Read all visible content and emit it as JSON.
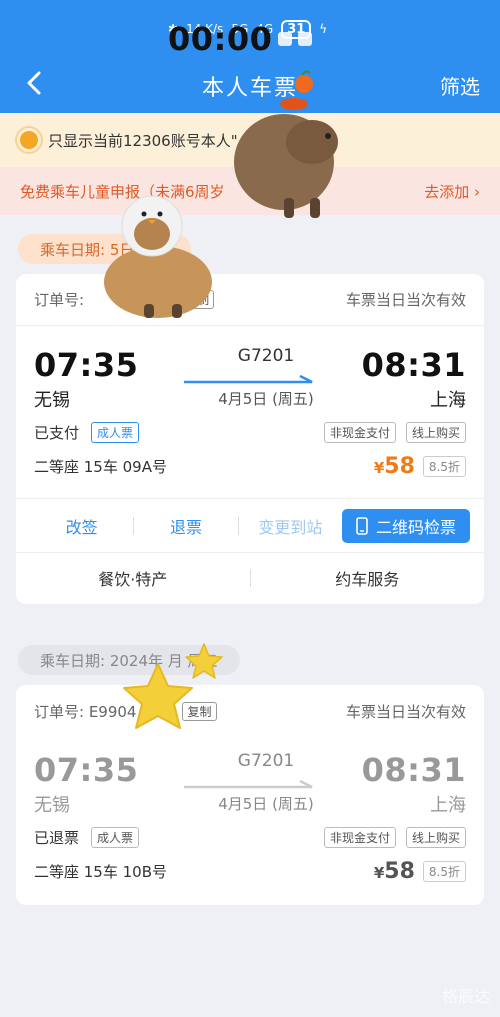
{
  "status_bar": {
    "time": "00:00",
    "net_speed": "14 K/s",
    "signal_5g": "5G",
    "signal_4g": "4G",
    "battery": "31"
  },
  "header": {
    "title": "本人车票",
    "filter_label": "筛选"
  },
  "notice": {
    "text": "只显示当前12306账号本人\"   行车票信息。"
  },
  "promo": {
    "text": "免费乘车儿童申报（未满6周岁",
    "action": "去添加 ›"
  },
  "tickets": [
    {
      "date_label": "乘车日期:             5日 周五",
      "order_label": "订单号:",
      "copy_label": "复制",
      "validity": "车票当日当次有效",
      "depart_time": "07:35",
      "depart_city": "无锡",
      "train_no": "G7201",
      "travel_date": "4月5日 (周五)",
      "arrive_time": "08:31",
      "arrive_city": "上海",
      "status": "已支付",
      "ticket_type": "成人票",
      "pay_tag": "非现金支付",
      "buy_tag": "线上购买",
      "seat": "二等座 15车 09A号",
      "currency": "¥",
      "price": "58",
      "discount": "8.5折",
      "actions": [
        "改签",
        "退票",
        "变更到站"
      ],
      "qr_label": "二维码检票",
      "extras": [
        "餐饮·特产",
        "约车服务"
      ]
    },
    {
      "date_label": "乘车日期: 2024年  月   周五",
      "order_label": "订单号:  E9904",
      "copy_label": "复制",
      "validity": "车票当日当次有效",
      "depart_time": "07:35",
      "depart_city": "无锡",
      "train_no": "G7201",
      "travel_date": "4月5日 (周五)",
      "arrive_time": "08:31",
      "arrive_city": "上海",
      "status": "已退票",
      "ticket_type": "成人票",
      "pay_tag": "非现金支付",
      "buy_tag": "线上购买",
      "seat": "二等座 15车 10B号",
      "currency": "¥",
      "price": "58",
      "discount": "8.5折"
    }
  ],
  "watermark": "格辰达",
  "colors": {
    "primary": "#2e8ff0",
    "accent_orange": "#f07a18",
    "notice_bg": "#fdf0d9",
    "promo_bg": "#fbe5e0"
  }
}
